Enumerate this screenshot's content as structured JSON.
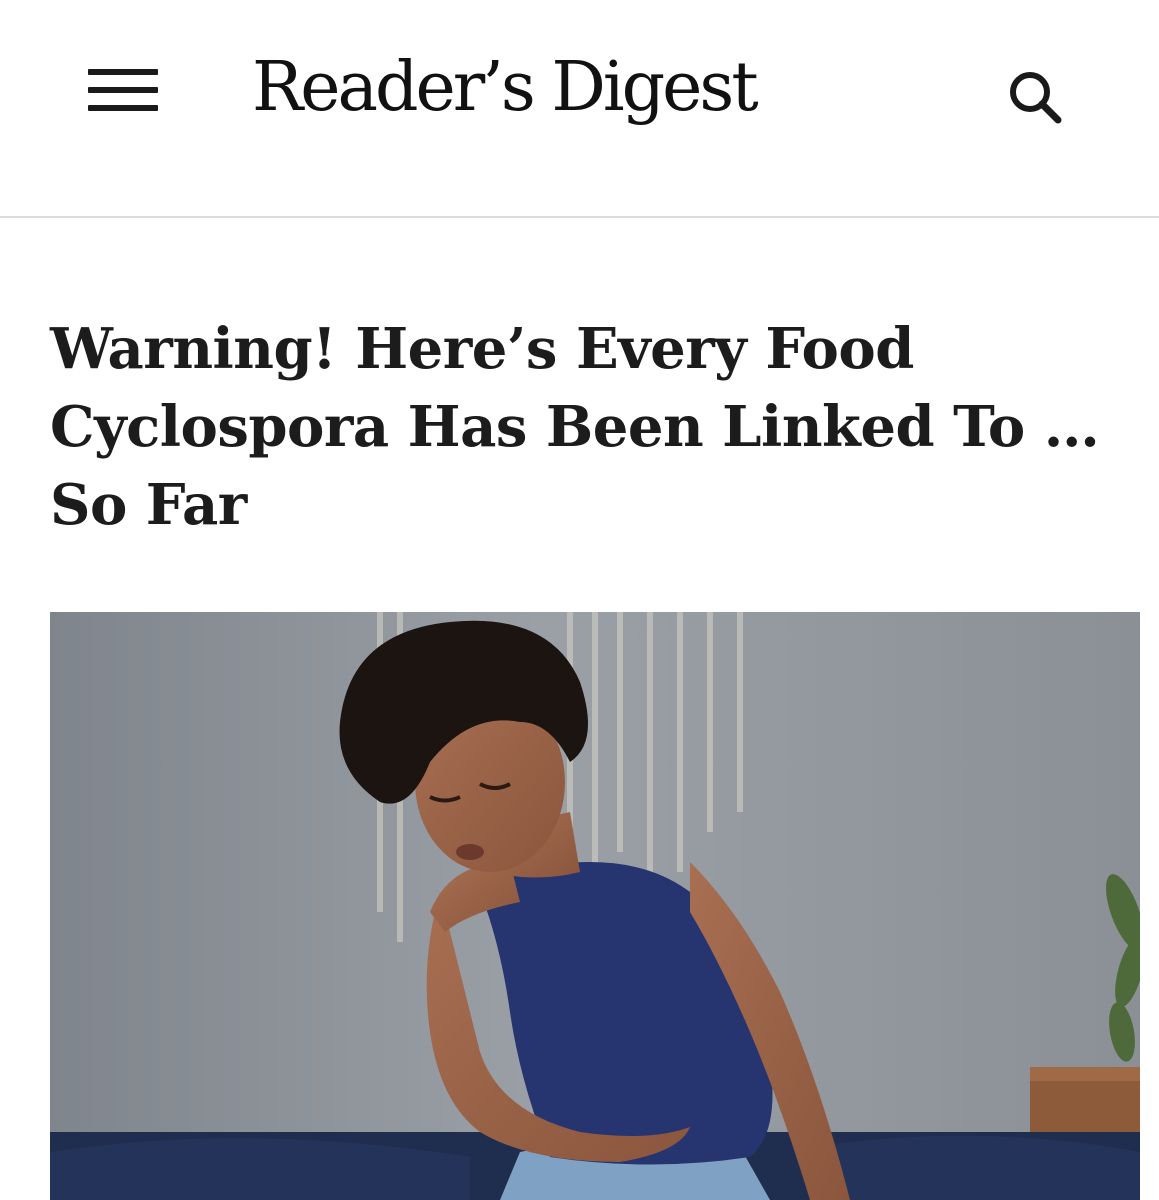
{
  "header": {
    "brand": "Reader’s Digest",
    "menu_icon": "hamburger-menu-icon",
    "search_icon": "search-icon"
  },
  "article": {
    "headline_lines": [
      "Warning! Here’s Every Food",
      "Cyclospora Has Been Linked To …",
      "So Far"
    ]
  },
  "colors": {
    "text": "#1a1a1a",
    "divider": "#dcdcdc",
    "background": "#ffffff"
  }
}
